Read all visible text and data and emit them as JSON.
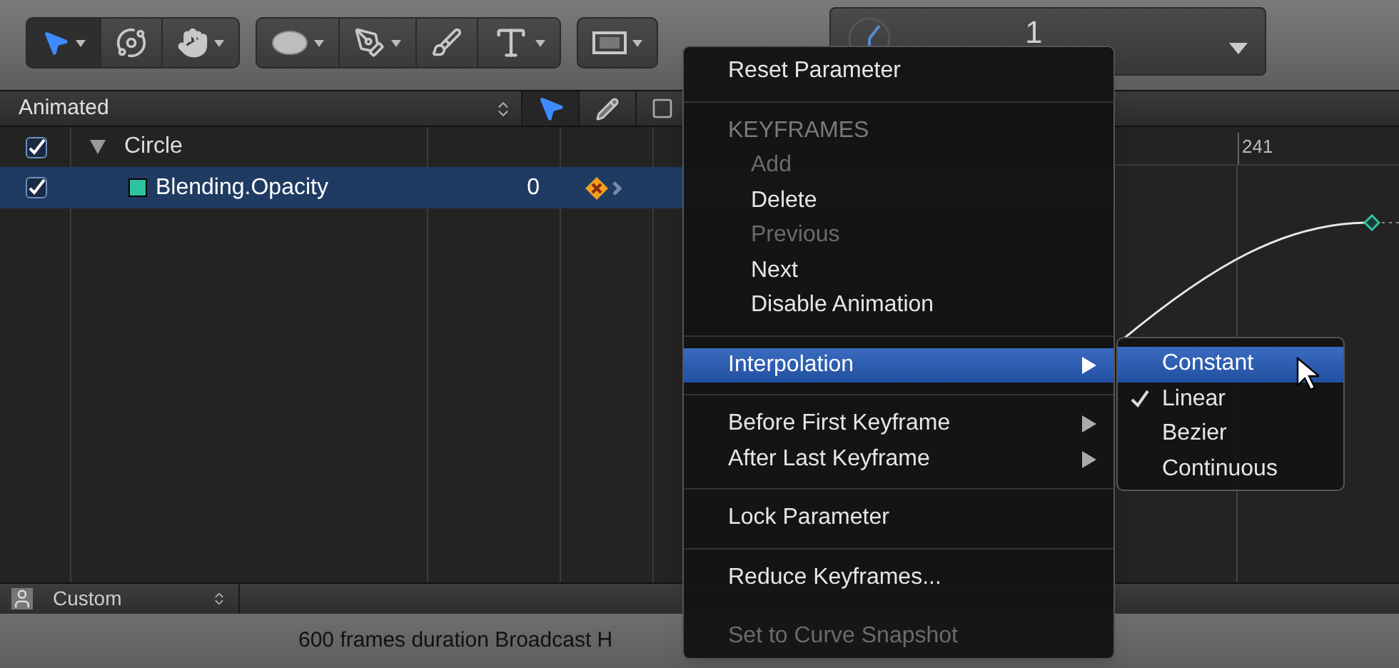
{
  "toolbar": {
    "groups": [
      {
        "tools": [
          {
            "kind": "arrow",
            "selected": true,
            "dropdown": true
          },
          {
            "kind": "orbit",
            "selected": false,
            "dropdown": false
          },
          {
            "kind": "hand",
            "selected": false,
            "dropdown": true
          }
        ]
      },
      {
        "tools": [
          {
            "kind": "ellipse",
            "selected": false,
            "dropdown": true
          },
          {
            "kind": "pen",
            "selected": false,
            "dropdown": true
          },
          {
            "kind": "brush",
            "selected": false,
            "dropdown": false
          },
          {
            "kind": "text",
            "selected": false,
            "dropdown": true
          }
        ]
      },
      {
        "tools": [
          {
            "kind": "frame",
            "selected": false,
            "dropdown": true
          }
        ]
      }
    ],
    "timecode": {
      "value": "1"
    }
  },
  "list": {
    "filter": "Animated",
    "tools": [
      {
        "kind": "arrow",
        "selected": true
      },
      {
        "kind": "pencil",
        "selected": false
      }
    ],
    "rows": [
      {
        "label": "Circle",
        "checked": true,
        "expanded": true,
        "children": [
          {
            "label": "Blending.Opacity",
            "checked": true,
            "selected": true,
            "color": "#2ec4a0",
            "value": "0"
          }
        ]
      }
    ]
  },
  "graph": {
    "ruler_label": "241"
  },
  "footer": {
    "preset": "Custom"
  },
  "status_bar": "600 frames duration Broadcast H",
  "context_menu": {
    "items": [
      {
        "kind": "item",
        "label": "Reset Parameter",
        "disabled": false,
        "selected": false,
        "submenu": false
      },
      {
        "kind": "separator"
      },
      {
        "kind": "header",
        "label": "KEYFRAMES"
      },
      {
        "kind": "subitem",
        "label": "Add",
        "disabled": true,
        "selected": false,
        "submenu": false
      },
      {
        "kind": "subitem",
        "label": "Delete",
        "disabled": false,
        "selected": false,
        "submenu": false
      },
      {
        "kind": "subitem",
        "label": "Previous",
        "disabled": true,
        "selected": false,
        "submenu": false
      },
      {
        "kind": "subitem",
        "label": "Next",
        "disabled": false,
        "selected": false,
        "submenu": false
      },
      {
        "kind": "subitem",
        "label": "Disable Animation",
        "disabled": false,
        "selected": false,
        "submenu": false
      },
      {
        "kind": "separator"
      },
      {
        "kind": "item",
        "label": "Interpolation",
        "disabled": false,
        "selected": true,
        "submenu": true
      },
      {
        "kind": "separator"
      },
      {
        "kind": "item",
        "label": "Before First Keyframe",
        "disabled": false,
        "selected": false,
        "submenu": true
      },
      {
        "kind": "item",
        "label": "After Last Keyframe",
        "disabled": false,
        "selected": false,
        "submenu": true
      },
      {
        "kind": "separator"
      },
      {
        "kind": "item",
        "label": "Lock Parameter",
        "disabled": false,
        "selected": false,
        "submenu": false
      },
      {
        "kind": "separator"
      },
      {
        "kind": "item",
        "label": "Reduce Keyframes...",
        "disabled": false,
        "selected": false,
        "submenu": false
      },
      {
        "kind": "gap"
      },
      {
        "kind": "item",
        "label": "Set to Curve Snapshot",
        "disabled": true,
        "selected": false,
        "submenu": false
      }
    ]
  },
  "submenu": {
    "items": [
      {
        "label": "Constant",
        "selected": true,
        "checked": false
      },
      {
        "label": "Linear",
        "selected": false,
        "checked": true
      },
      {
        "label": "Bezier",
        "selected": false,
        "checked": false
      },
      {
        "label": "Continuous",
        "selected": false,
        "checked": false
      }
    ]
  }
}
